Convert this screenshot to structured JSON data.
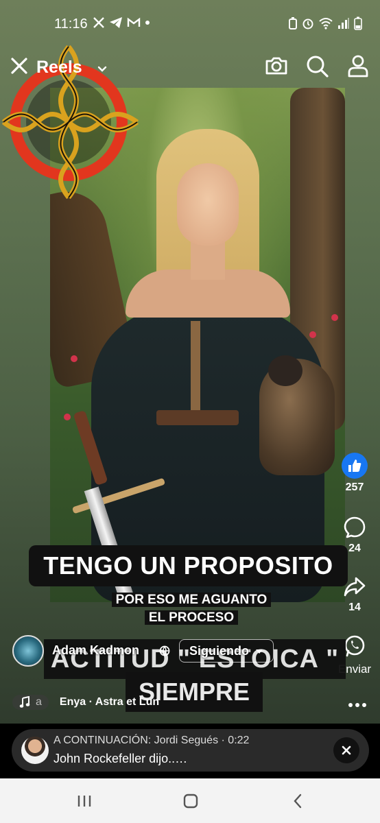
{
  "status_bar": {
    "time": "11:16",
    "left_icons": [
      "x-icon",
      "telegram-icon",
      "gmail-icon",
      "dot-icon"
    ],
    "right_icons": [
      "battery-saver-icon",
      "alarm-icon",
      "wifi-icon",
      "signal-icon",
      "battery-icon"
    ]
  },
  "top_bar": {
    "title": "Reels",
    "icons": [
      "close-icon",
      "chevron-down-icon",
      "camera-icon",
      "search-icon",
      "profile-icon"
    ]
  },
  "actions": {
    "like_count": "257",
    "comment_count": "24",
    "share_count": "14",
    "send_label": "Enviar"
  },
  "captions": {
    "main": "TENGO UN PROPOSITO",
    "sub_line1": "POR ESO ME AGUANTO",
    "sub_line2": "EL PROCESO",
    "big_line1": "ACTITUD \" ESTOICA \"",
    "big_line2": "SIEMPRE"
  },
  "author": {
    "name": "Adam Kadmon",
    "follow_label": "Siguiendo"
  },
  "music": {
    "prefix": "a",
    "track": "Enya · Astra et Lun"
  },
  "up_next": {
    "label": "A CONTINUACIÓN: Jordi Segués · 0:22",
    "title": "John Rockefeller dijo..…"
  },
  "colors": {
    "like_blue": "#1877f2",
    "caption_bg": "#111111",
    "card_bg": "#2a2a2a",
    "nav_bg": "#f3f3f3"
  }
}
